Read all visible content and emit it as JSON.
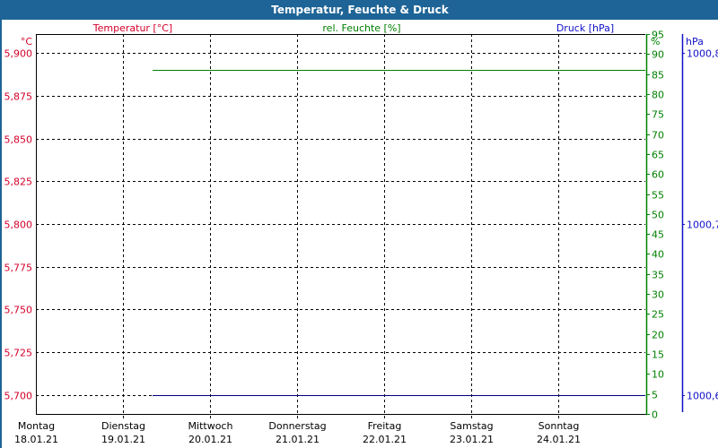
{
  "window": {
    "title": "Temperatur, Feuchte & Druck"
  },
  "chart_data": {
    "type": "line",
    "title": "Temperatur, Feuchte & Druck",
    "grid": true,
    "colors": {
      "temperature": "#d4002a",
      "humidity": "#008000",
      "pressure": "#1010c8",
      "pressure_line": "#000080",
      "titlebar": "#1e6496"
    },
    "x_axis": {
      "categories": [
        {
          "day": "Montag",
          "date": "18.01.21"
        },
        {
          "day": "Dienstag",
          "date": "19.01.21"
        },
        {
          "day": "Mittwoch",
          "date": "20.01.21"
        },
        {
          "day": "Donnerstag",
          "date": "21.01.21"
        },
        {
          "day": "Freitag",
          "date": "22.01.21"
        },
        {
          "day": "Samstag",
          "date": "23.01.21"
        },
        {
          "day": "Sonntag",
          "date": "24.01.21"
        }
      ],
      "range_days": [
        0,
        7
      ]
    },
    "axes": {
      "temperature": {
        "label": "Temperatur [°C]",
        "unit": "°C",
        "range": [
          5.689,
          5.911
        ],
        "ticks": [
          "5,900",
          "5,875",
          "5,850",
          "5,825",
          "5,800",
          "5,775",
          "5,750",
          "5,725",
          "5,700"
        ],
        "tick_values": [
          5.9,
          5.875,
          5.85,
          5.825,
          5.8,
          5.775,
          5.75,
          5.725,
          5.7
        ]
      },
      "humidity": {
        "label": "rel. Feuchte [%]",
        "unit": "%",
        "range": [
          0,
          95
        ],
        "ticks": [
          "95",
          "90",
          "85",
          "80",
          "75",
          "70",
          "65",
          "60",
          "55",
          "50",
          "45",
          "40",
          "35",
          "30",
          "25",
          "20",
          "15",
          "10",
          "5",
          "0"
        ],
        "tick_values": [
          95,
          90,
          85,
          80,
          75,
          70,
          65,
          60,
          55,
          50,
          45,
          40,
          35,
          30,
          25,
          20,
          15,
          10,
          5,
          0
        ]
      },
      "pressure": {
        "label": "Druck [hPa]",
        "unit": "hPa",
        "range": [
          1000.589,
          1000.811
        ],
        "ticks": [
          "1000,8",
          "1000,7",
          "1000,6"
        ],
        "tick_values": [
          1000.8,
          1000.7,
          1000.6
        ]
      }
    },
    "series": [
      {
        "axis": "humidity",
        "x_days": [
          1.34,
          7
        ],
        "values": [
          86,
          86
        ]
      },
      {
        "axis": "pressure",
        "x_days": [
          1.34,
          7
        ],
        "values": [
          1000.6,
          1000.6
        ]
      }
    ]
  }
}
